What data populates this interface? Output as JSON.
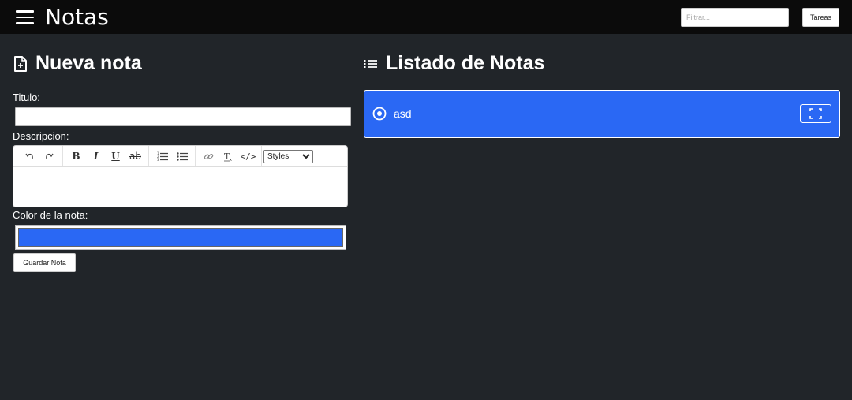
{
  "header": {
    "app_title": "Notas",
    "filter_placeholder": "Filtrar...",
    "tasks_label": "Tareas"
  },
  "new_note": {
    "heading": "Nueva nota",
    "title_label": "Titulo:",
    "title_value": "",
    "description_label": "Descripcion:",
    "toolbar": {
      "undo_icon": "undo-icon",
      "redo_icon": "redo-icon",
      "bold": "B",
      "italic": "I",
      "underline": "U",
      "strike": "ab",
      "ordered_list_icon": "ordered-list-icon",
      "bullet_list_icon": "bullet-list-icon",
      "link_icon": "link-icon",
      "clear_format_icon": "clear-format-icon",
      "code": "</>",
      "styles_selected": "Styles"
    },
    "color_label": "Color de la nota:",
    "color_value": "#2a68f4",
    "save_label": "Guardar Nota"
  },
  "notes_list": {
    "heading": "Listado de Notas",
    "notes": [
      {
        "title": "asd",
        "color": "#2a68f4"
      }
    ]
  },
  "colors": {
    "background": "#212529",
    "topbar": "#0b0b0b",
    "note_blue": "#2a68f4"
  }
}
